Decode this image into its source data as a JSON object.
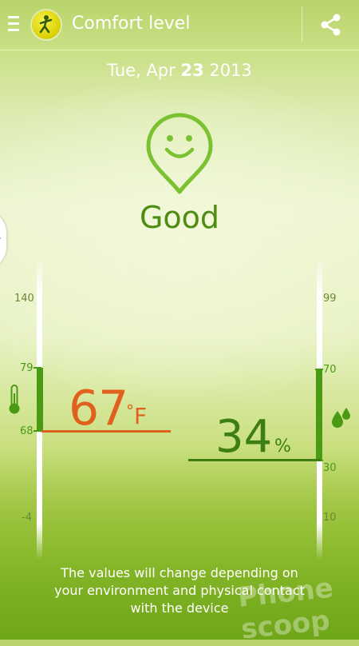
{
  "header": {
    "title": "Comfort level"
  },
  "date": {
    "prefix": "Tue, Apr ",
    "day": "23",
    "year": " 2013"
  },
  "comfort": {
    "status": "Good"
  },
  "temperature": {
    "value": "67",
    "unit": "F",
    "degree": "°",
    "ticks": [
      "140",
      "79",
      "68",
      "-4"
    ],
    "comfort_range": [
      68,
      79
    ],
    "color": "#e0601d"
  },
  "humidity": {
    "value": "34",
    "unit": "%",
    "ticks": [
      "99",
      "70",
      "30",
      "10"
    ],
    "comfort_range": [
      30,
      70
    ],
    "color": "#3c7e12"
  },
  "footer": {
    "note": "The values will change depending on your environment and physical contact with the device"
  },
  "watermark": "Phone scoop",
  "colors": {
    "accent": "#4f8d12",
    "range": "#4a9a14"
  }
}
